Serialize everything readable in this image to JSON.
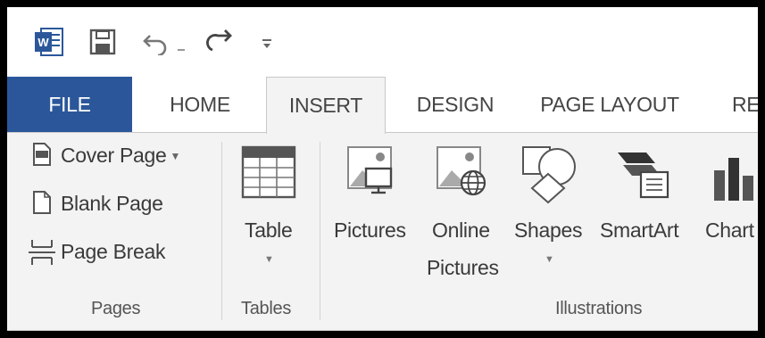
{
  "quick_access": {
    "items": [
      "word-app-icon",
      "save-icon",
      "undo-icon",
      "redo-icon",
      "customize-qat-icon"
    ]
  },
  "tabs": [
    {
      "label": "FILE"
    },
    {
      "label": "HOME"
    },
    {
      "label": "INSERT"
    },
    {
      "label": "DESIGN"
    },
    {
      "label": "PAGE LAYOUT"
    },
    {
      "label": "RE"
    }
  ],
  "groups": {
    "pages": {
      "label": "Pages",
      "cover_page": "Cover Page",
      "blank_page": "Blank Page",
      "page_break": "Page Break"
    },
    "tables": {
      "label": "Tables",
      "table": "Table"
    },
    "illustrations": {
      "label": "Illustrations",
      "pictures": "Pictures",
      "online_line1": "Online",
      "online_line2": "Pictures",
      "shapes": "Shapes",
      "smartart": "SmartArt",
      "chart": "Chart"
    }
  },
  "colors": {
    "file_tab": "#2b579a",
    "ribbon_bg": "#f3f3f3",
    "word_blue": "#2b579a"
  }
}
